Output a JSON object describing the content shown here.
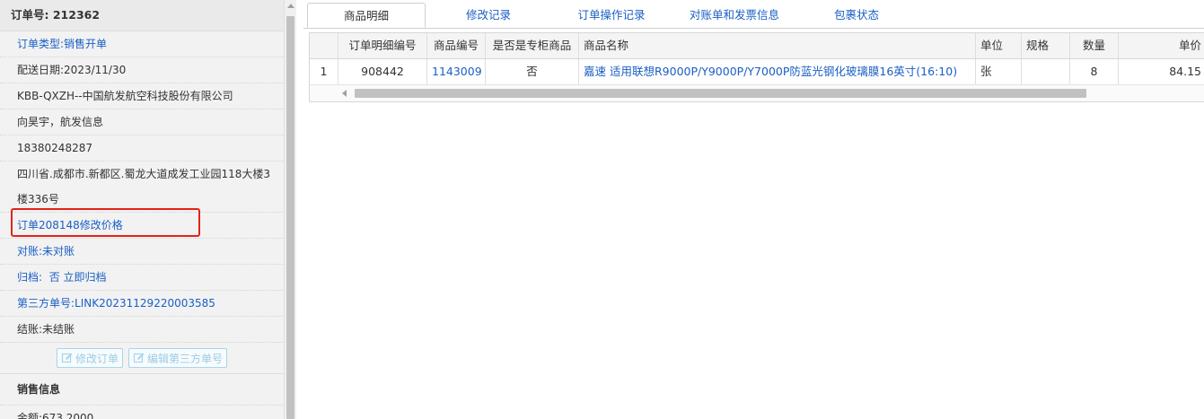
{
  "order": {
    "number_label": "订单号:",
    "number": "212362",
    "type_label": "订单类型:",
    "type": "销售开单",
    "delivery_date": "配送日期:2023/11/30",
    "customer": "KBB-QXZH--中国航发航空科技股份有限公司",
    "contact": "向昊宇，航发信息",
    "phone": "18380248287",
    "address": "四川省.成都市.新都区.蜀龙大道成发工业园118大楼3楼336号",
    "price_change_note": "订单208148修改价格",
    "reconcile_label": "对账:",
    "reconcile": "未对账",
    "archive_label": "归档:",
    "archive": "否",
    "archive_action": "立即归档",
    "third_party_label": "第三方单号:",
    "third_party": "LINK20231129220003585",
    "settle_label": "结账:",
    "settle": "未结账",
    "edit_order_button": "修改订单",
    "edit_third_party_button": "编辑第三方单号",
    "sales_section_title": "销售信息",
    "amount_label": "金额:",
    "amount": "673.2000"
  },
  "tabs": [
    {
      "label": "商品明细",
      "active": true
    },
    {
      "label": "修改记录",
      "active": false
    },
    {
      "label": "订单操作记录",
      "active": false
    },
    {
      "label": "对账单和发票信息",
      "active": false
    },
    {
      "label": "包裹状态",
      "active": false
    }
  ],
  "grid": {
    "columns": [
      "订单明细编号",
      "商品编号",
      "是否是专柜商品",
      "商品名称",
      "单位",
      "规格",
      "数量",
      "单价"
    ],
    "rows": [
      {
        "row_number": "1",
        "detail_id": "908442",
        "product_code": "1143009",
        "is_counter": "否",
        "product_name": "嘉速 适用联想R9000P/Y9000P/Y7000P防蓝光钢化玻璃膜16英寸(16:10)",
        "unit": "张",
        "spec": "",
        "quantity": "8",
        "unit_price": "84.15"
      }
    ]
  },
  "colors": {
    "link": "#1a5fc4",
    "highlight": "#e2231a",
    "ghost_button": "#9ccce4"
  },
  "icons": {
    "edit": "pencil-square-icon"
  }
}
